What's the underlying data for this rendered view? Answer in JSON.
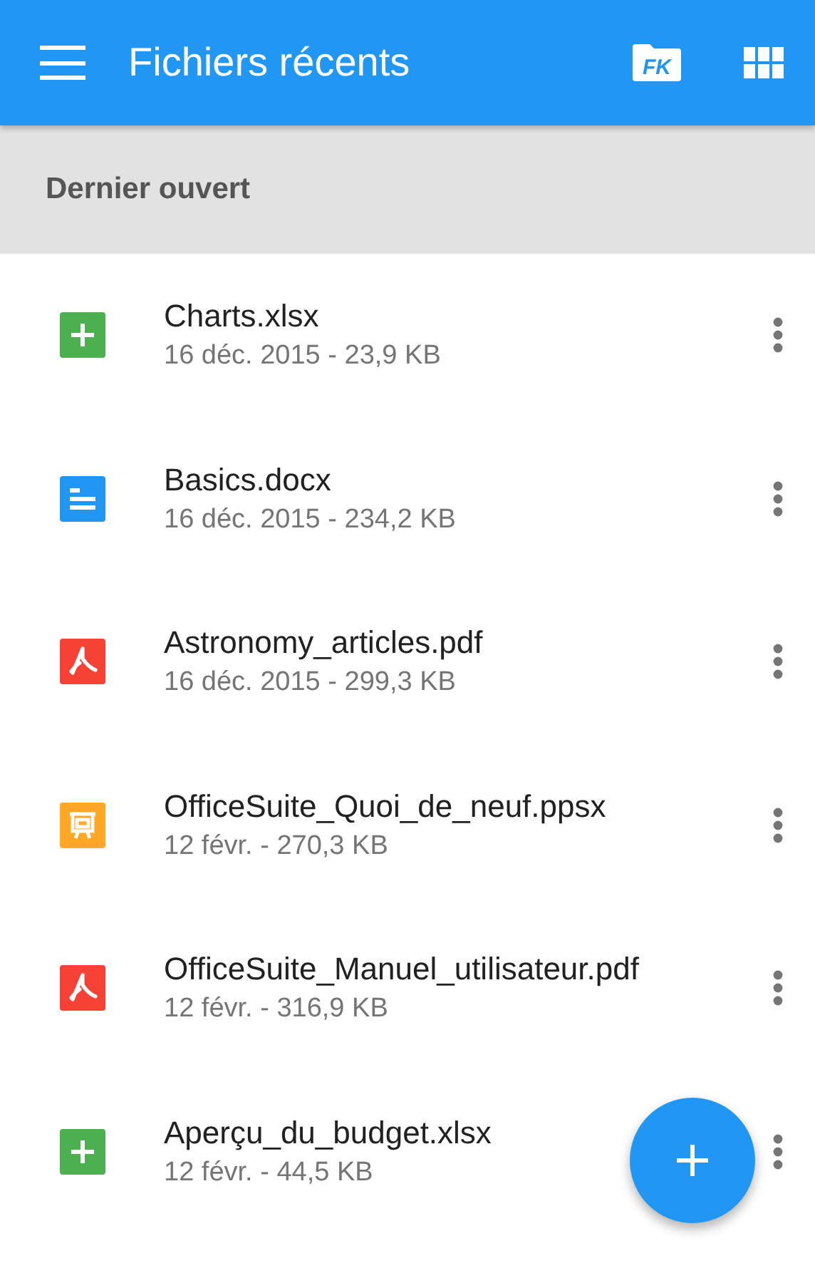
{
  "app_bar": {
    "title": "Fichiers récents",
    "logo_text": "FK"
  },
  "section": {
    "title": "Dernier ouvert"
  },
  "files": [
    {
      "kind": "sheet",
      "name": "Charts.xlsx",
      "details": "16 déc. 2015 - 23,9 KB"
    },
    {
      "kind": "doc",
      "name": "Basics.docx",
      "details": "16 déc. 2015 - 234,2 KB"
    },
    {
      "kind": "pdf",
      "name": "Astronomy_articles.pdf",
      "details": "16 déc. 2015 - 299,3 KB"
    },
    {
      "kind": "slides",
      "name": "OfficeSuite_Quoi_de_neuf.ppsx",
      "details": "12 févr. - 270,3 KB"
    },
    {
      "kind": "pdf",
      "name": "OfficeSuite_Manuel_utilisateur.pdf",
      "details": "12 févr. - 316,9 KB"
    },
    {
      "kind": "sheet",
      "name": "Aperçu_du_budget.xlsx",
      "details": "12 févr. - 44,5 KB"
    }
  ]
}
